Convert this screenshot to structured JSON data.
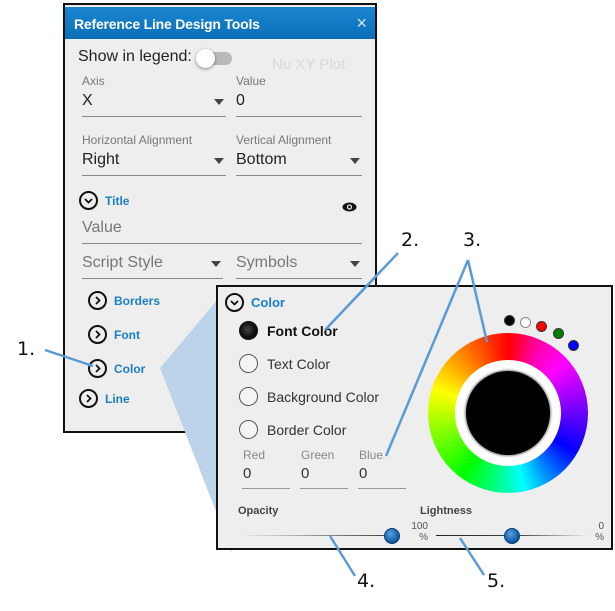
{
  "panel": {
    "title": "Reference Line Design Tools",
    "close_icon": "×",
    "show_in_legend_label": "Show in legend:",
    "show_in_legend": false,
    "ghost_text": "Nu XY Plot",
    "axis": {
      "label": "Axis",
      "value": "X"
    },
    "value": {
      "label": "Value",
      "value": "0"
    },
    "horizontal_alignment": {
      "label": "Horizontal Alignment",
      "value": "Right"
    },
    "vertical_alignment": {
      "label": "Vertical Alignment",
      "value": "Bottom"
    },
    "title_section": {
      "label": "Title",
      "value_placeholder": "Value",
      "script_style": "Script Style",
      "symbols": "Symbols"
    },
    "sections": [
      {
        "label": "Borders"
      },
      {
        "label": "Font"
      },
      {
        "label": "Color"
      },
      {
        "label": "Line"
      }
    ]
  },
  "color_panel": {
    "header": "Color",
    "targets": [
      {
        "label": "Font Color",
        "selected": true
      },
      {
        "label": "Text Color",
        "selected": false
      },
      {
        "label": "Background Color",
        "selected": false
      },
      {
        "label": "Border Color",
        "selected": false
      }
    ],
    "rgb": [
      {
        "label": "Red",
        "value": "0"
      },
      {
        "label": "Green",
        "value": "0"
      },
      {
        "label": "Blue",
        "value": "0"
      }
    ],
    "opacity": {
      "label": "Opacity",
      "value_percent": 100
    },
    "lightness": {
      "label": "Lightness",
      "min_label": "100",
      "max_label": "0",
      "unit": "%",
      "value_percent": 50
    },
    "current_color": "#000000",
    "presets": [
      "#000000",
      "#ffffff",
      "#ff0000",
      "#008000",
      "#0000ff"
    ]
  },
  "callouts": [
    "1.",
    "2.",
    "3.",
    "4.",
    "5."
  ],
  "colors": {
    "accent": "#1a7fc4",
    "titlebar": "#0f78c2",
    "callout_line": "#5b9bd5",
    "wedge": "#b9d1e8"
  }
}
